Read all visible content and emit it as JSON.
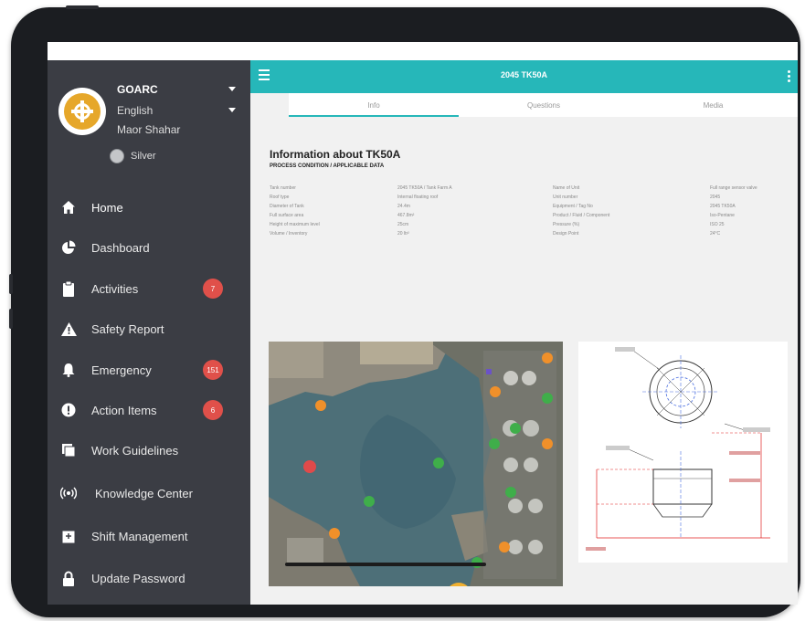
{
  "app": {
    "brand": "GOARC",
    "language": "English",
    "user_name": "Maor Shahar",
    "tier": "Silver",
    "page_title": "2045 TK50A"
  },
  "sidebar": {
    "items": [
      {
        "label": "Home",
        "icon": "home-icon",
        "badge": ""
      },
      {
        "label": "Dashboard",
        "icon": "pie-chart-icon",
        "badge": ""
      },
      {
        "label": "Activities",
        "icon": "clipboard-icon",
        "badge": "7"
      },
      {
        "label": "Safety Report",
        "icon": "warning-icon",
        "badge": ""
      },
      {
        "label": "Emergency",
        "icon": "bell-icon",
        "badge": "151"
      },
      {
        "label": "Action Items",
        "icon": "exclamation-icon",
        "badge": "6"
      },
      {
        "label": "Work Guidelines",
        "icon": "book-icon",
        "badge": ""
      },
      {
        "label": "Knowledge Center",
        "icon": "broadcast-icon",
        "badge": ""
      },
      {
        "label": "Shift Management",
        "icon": "shift-icon",
        "badge": ""
      },
      {
        "label": "Update Password",
        "icon": "lock-icon",
        "badge": ""
      }
    ]
  },
  "tabs": [
    {
      "label": "Info"
    },
    {
      "label": "Questions"
    },
    {
      "label": "Media"
    }
  ],
  "info": {
    "title": "Information about TK50A",
    "subtitle": "PROCESS CONDITION / APPLICABLE DATA",
    "rows": [
      [
        "Tank number",
        "2045 TK50A / Tank Farm A",
        "Name of Unit",
        "Full range sensor valve"
      ],
      [
        "Roof type",
        "Internal floating roof",
        "Unit number",
        "2045"
      ],
      [
        "Diameter of Tank",
        "24.4m",
        "Equipment / Tag No",
        "2045 TK50A"
      ],
      [
        "Full surface area",
        "467.8m²",
        "Product / Fluid / Component",
        "Iso-Pentane"
      ],
      [
        "Height of maximum level",
        "25cm",
        "Pressure (%)",
        "ISO 25"
      ],
      [
        "Volume / Inventory",
        "20 ltr²",
        "Design Point",
        "24°C"
      ]
    ]
  },
  "colors": {
    "sidebar_bg": "#3b3d44",
    "accent": "#26b7b9",
    "badge": "#e0504a",
    "logo": "#e6a72a",
    "main_bg": "#f1f1f1",
    "device_frame": "#1b1d21"
  }
}
